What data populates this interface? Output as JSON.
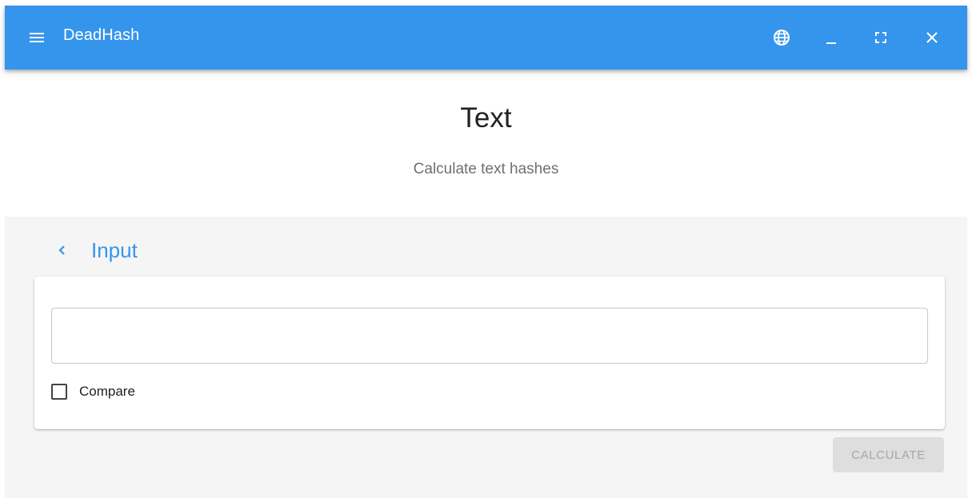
{
  "app": {
    "title": "DeadHash",
    "accent_color": "#3595ec"
  },
  "appbar": {
    "menu_icon": "menu-icon",
    "language_icon": "globe-icon",
    "minimize_icon": "minimize-icon",
    "fullscreen_icon": "fullscreen-icon",
    "close_icon": "close-icon"
  },
  "page": {
    "title": "Text",
    "subtitle": "Calculate text hashes"
  },
  "section": {
    "back_icon": "chevron-left-icon",
    "title": "Input"
  },
  "form": {
    "input_value": "",
    "compare_label": "Compare",
    "compare_checked": false,
    "calculate_label": "CALCULATE",
    "calculate_enabled": false
  }
}
